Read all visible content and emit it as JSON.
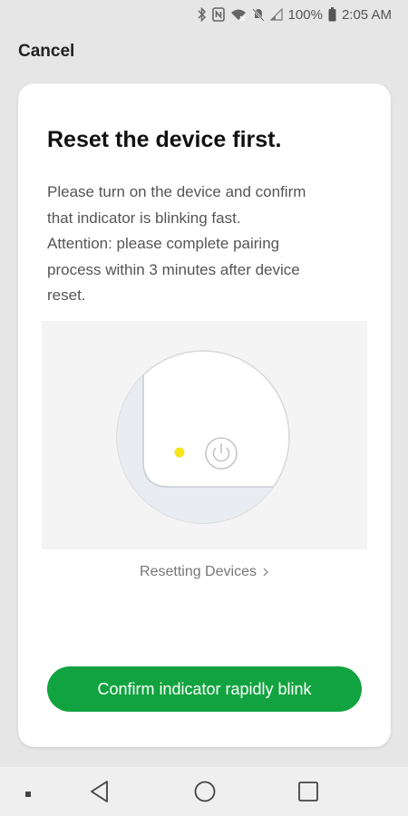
{
  "status_bar": {
    "battery": "100%",
    "time": "2:05 AM",
    "icons": [
      "bluetooth-icon",
      "nfc-icon",
      "wifi-icon",
      "mute-icon",
      "signal-icon",
      "battery-icon"
    ]
  },
  "header": {
    "cancel_label": "Cancel"
  },
  "card": {
    "title": "Reset the device first.",
    "instruction_lines": [
      "Please turn on the device and confirm",
      "that indicator is blinking fast.",
      "Attention: please complete pairing",
      "process within 3 minutes after device",
      "reset."
    ],
    "link_label": "Resetting Devices",
    "link_icon": "chevron-right-icon",
    "illustration_icons": [
      "indicator-led-icon",
      "power-icon"
    ],
    "button_label": "Confirm indicator rapidly blink"
  },
  "colors": {
    "accent": "#11a33f",
    "indicator": "#f6e41c",
    "background": "#e6e6e6"
  },
  "nav_bar": {
    "icons": [
      "dot-icon",
      "back-icon",
      "home-icon",
      "recents-icon"
    ]
  }
}
